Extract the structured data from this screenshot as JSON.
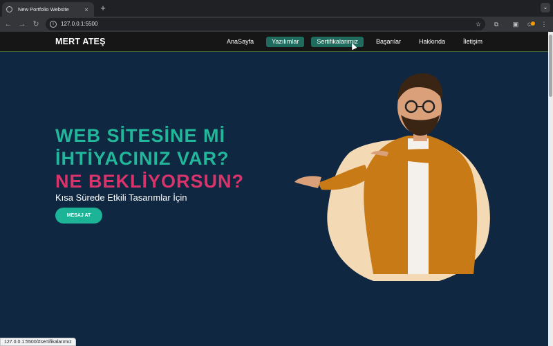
{
  "browser": {
    "tab_title": "New Portfolio Website",
    "tab_close": "×",
    "new_tab": "+",
    "tab_menu": "⌄",
    "url": "127.0.0.1:5500",
    "status_url": "127.0.0.1:5500/#sertifikalarımız",
    "icons": [
      "globe-icon",
      "back-icon",
      "forward-icon",
      "reload-icon",
      "info-icon",
      "star-icon",
      "extensions-icon",
      "sidepanel-icon",
      "profile-icon",
      "menu-icon"
    ]
  },
  "site": {
    "brand": "MERT ATEŞ",
    "nav": [
      {
        "label": "AnaSayfa",
        "active": false
      },
      {
        "label": "Yazılımlar",
        "active": true
      },
      {
        "label": "Sertifikalarımız",
        "active": true
      },
      {
        "label": "Başarılar",
        "active": false
      },
      {
        "label": "Hakkında",
        "active": false
      },
      {
        "label": "İletişim",
        "active": false
      }
    ],
    "hero": {
      "line1": "WEB SİTESİNE Mİ",
      "line2": "İHTİYACINIZ VAR?",
      "line3": "NE BEKLİYORSUN?",
      "subtitle": "Kısa Sürede Etkili Tasarımlar İçin",
      "cta": "MESAJ AT"
    }
  },
  "colors": {
    "page_bg": "#0f2740",
    "accent_green": "#22b79a",
    "accent_pink": "#d8346b",
    "nav_active": "#1f6b5d",
    "nav_bg": "#161616",
    "blob": "#f4d9b5",
    "jacket": "#c77a16"
  }
}
